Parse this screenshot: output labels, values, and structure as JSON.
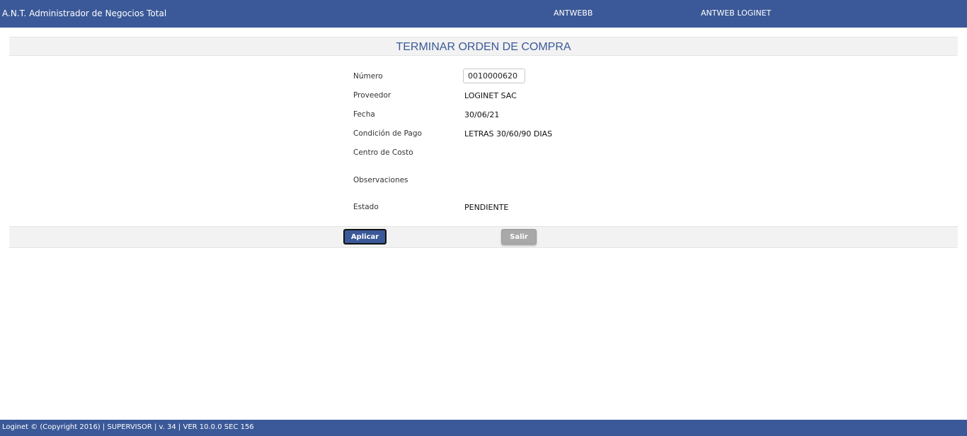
{
  "header": {
    "app_title": "A.N.T. Administrador de Negocios Total",
    "company": "ANTWEBB",
    "user": "ANTWEB LOGINET"
  },
  "page": {
    "title": "TERMINAR ORDEN DE COMPRA"
  },
  "form": {
    "numero": {
      "label": "Número",
      "value": "0010000620"
    },
    "proveedor": {
      "label": "Proveedor",
      "value": "LOGINET SAC"
    },
    "fecha": {
      "label": "Fecha",
      "value": "30/06/21"
    },
    "condicion_pago": {
      "label": "Condición de Pago",
      "value": "LETRAS 30/60/90 DIAS"
    },
    "centro_costo": {
      "label": "Centro de Costo",
      "value": ""
    },
    "observaciones": {
      "label": "Observaciones",
      "value": ""
    },
    "estado": {
      "label": "Estado",
      "value": "PENDIENTE"
    }
  },
  "actions": {
    "apply_label": "Aplicar",
    "exit_label": "Salir"
  },
  "footer": {
    "text": "Loginet © (Copyright 2016) | SUPERVISOR | v. 34 | VER 10.0.0 SEC 156"
  },
  "colors": {
    "brand": "#3b5998",
    "exit_button": "#a9a9a9",
    "band_background": "#f2f2f2"
  }
}
